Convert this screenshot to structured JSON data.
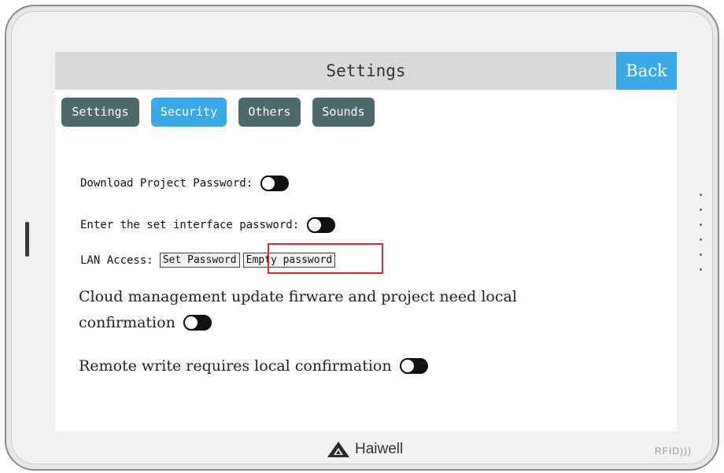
{
  "header": {
    "title": "Settings",
    "back_label": "Back"
  },
  "tabs": [
    {
      "label": "Settings",
      "active": false
    },
    {
      "label": "Security",
      "active": true
    },
    {
      "label": "Others",
      "active": false
    },
    {
      "label": "Sounds",
      "active": false
    }
  ],
  "security": {
    "download_password_label": "Download Project Password:",
    "download_password_enabled": false,
    "set_interface_password_label": "Enter the set interface password:",
    "set_interface_password_enabled": false,
    "lan_access_label": "LAN Access:",
    "lan_set_password_label": "Set Password",
    "lan_empty_password_label": "Empty password",
    "cloud_confirm_label_line1": "Cloud management update firware and project need local",
    "cloud_confirm_label_line2": "confirmation",
    "cloud_confirm_enabled": false,
    "remote_write_label": "Remote write requires local confirmation",
    "remote_write_enabled": false
  },
  "device": {
    "brand": "Haiwell",
    "rfid_label": "RFID"
  },
  "colors": {
    "accent": "#3aaae6",
    "tab_inactive": "#4f6a6b",
    "titlebar": "#d9d9d9",
    "highlight": "#d62b2b"
  }
}
